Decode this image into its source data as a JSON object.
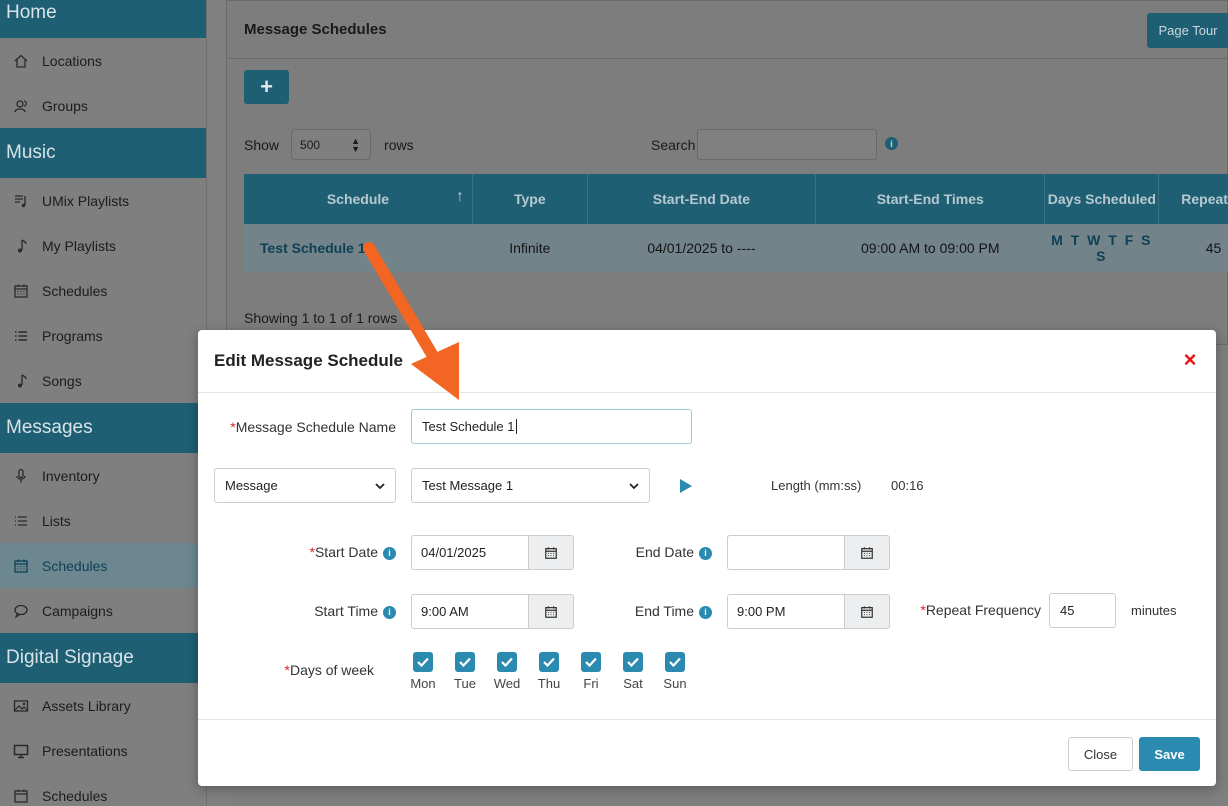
{
  "sidebar": {
    "sections": [
      {
        "title": "Home",
        "items": [
          {
            "label": "Locations",
            "icon": "home-icon"
          },
          {
            "label": "Groups",
            "icon": "groups-icon"
          }
        ]
      },
      {
        "title": "Music",
        "items": [
          {
            "label": "UMix Playlists",
            "icon": "playlist-icon"
          },
          {
            "label": "My Playlists",
            "icon": "music-note-icon"
          },
          {
            "label": "Schedules",
            "icon": "calendar-icon"
          },
          {
            "label": "Programs",
            "icon": "list-icon"
          },
          {
            "label": "Songs",
            "icon": "music-note-icon"
          }
        ]
      },
      {
        "title": "Messages",
        "items": [
          {
            "label": "Inventory",
            "icon": "microphone-icon"
          },
          {
            "label": "Lists",
            "icon": "list-icon"
          },
          {
            "label": "Schedules",
            "icon": "calendar-icon",
            "active": true
          },
          {
            "label": "Campaigns",
            "icon": "chat-bubble-icon"
          }
        ]
      },
      {
        "title": "Digital Signage",
        "items": [
          {
            "label": "Assets Library",
            "icon": "image-icon"
          },
          {
            "label": "Presentations",
            "icon": "monitor-icon"
          },
          {
            "label": "Schedules",
            "icon": "calendar-icon"
          }
        ]
      }
    ]
  },
  "page": {
    "title": "Message Schedules",
    "tour_label": "Page Tour",
    "add_label": "+",
    "show_label": "Show",
    "rows_value": "500",
    "rows_label": "rows",
    "search_label": "Search",
    "search_value": "",
    "showing_text": "Showing 1 to 1 of 1 rows"
  },
  "table": {
    "headers": [
      "Schedule",
      "Type",
      "Start-End Date",
      "Start-End Times",
      "Days Scheduled",
      "Repeat"
    ],
    "rows": [
      {
        "schedule": "Test Schedule 1",
        "type": "Infinite",
        "date": "04/01/2025 to ----",
        "times": "09:00 AM to 09:00 PM",
        "days": "MTWTFSS",
        "repeat": "45"
      }
    ]
  },
  "modal": {
    "title": "Edit Message Schedule",
    "close_icon": "×",
    "name_label": "Message Schedule Name",
    "name_value": "Test Schedule 1",
    "type_select": "Message",
    "message_select": "Test Message 1",
    "length_label": "Length (mm:ss)",
    "length_value": "00:16",
    "start_date_label": "Start Date",
    "start_date_value": "04/01/2025",
    "end_date_label": "End Date",
    "end_date_value": "",
    "start_time_label": "Start Time",
    "start_time_value": "9:00 AM",
    "end_time_label": "End Time",
    "end_time_value": "9:00 PM",
    "repeat_label": "Repeat Frequency",
    "repeat_value": "45",
    "repeat_unit": "minutes",
    "days_label": "Days of week",
    "days": [
      "Mon",
      "Tue",
      "Wed",
      "Thu",
      "Fri",
      "Sat",
      "Sun"
    ],
    "close_button": "Close",
    "save_button": "Save",
    "required_mark": "*",
    "info_mark": "i"
  },
  "colors": {
    "accent": "#2a8ab0",
    "sidebar_header": "#1f5f74",
    "annotation_arrow": "#f26522",
    "close_x": "#e11111"
  }
}
